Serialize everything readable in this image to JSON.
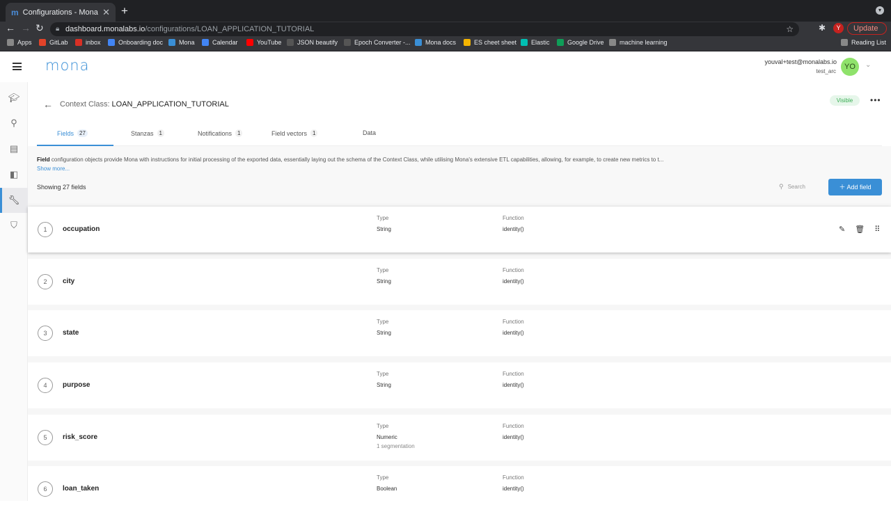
{
  "browser": {
    "tab_title": "Configurations - Mona",
    "url_host": "dashboard.monalabs.io",
    "url_path": "/configurations/LOAN_APPLICATION_TUTORIAL",
    "update_label": "Update",
    "profile_initial": "Y",
    "bookmarks": [
      {
        "label": "Apps",
        "color": "#888888"
      },
      {
        "label": "GitLab",
        "color": "#e24329"
      },
      {
        "label": "inbox",
        "color": "#d93025"
      },
      {
        "label": "Onboarding doc",
        "color": "#4285f4"
      },
      {
        "label": "Mona",
        "color": "#3a8fd6"
      },
      {
        "label": "Calendar",
        "color": "#4285f4"
      },
      {
        "label": "YouTube",
        "color": "#ff0000"
      },
      {
        "label": "JSON beautify",
        "color": "#555555"
      },
      {
        "label": "Epoch Converter -...",
        "color": "#555555"
      },
      {
        "label": "Mona docs",
        "color": "#3a8fd6"
      },
      {
        "label": "ES cheet sheet",
        "color": "#f4b400"
      },
      {
        "label": "Elastic",
        "color": "#00bfb3"
      },
      {
        "label": "Google Drive",
        "color": "#0f9d58"
      },
      {
        "label": "machine learning",
        "color": "#888888"
      }
    ],
    "reading_list": "Reading List"
  },
  "app": {
    "logo": "mona",
    "user_email": "youval+test@monalabs.io",
    "user_org": "test_arc",
    "avatar_initials": "YO"
  },
  "page": {
    "context_label": "Context Class:",
    "context_name": "LOAN_APPLICATION_TUTORIAL",
    "visible_badge": "Visible",
    "tabs": [
      {
        "label": "Fields",
        "count": "27"
      },
      {
        "label": "Stanzas",
        "count": "1"
      },
      {
        "label": "Notifications",
        "count": "1"
      },
      {
        "label": "Field vectors",
        "count": "1"
      },
      {
        "label": "Data",
        "count": ""
      }
    ],
    "description_bold": "Field",
    "description": " configuration objects provide Mona with instructions for initial processing of the exported data, essentially laying out the schema of the Context Class, while utilising Mona's extensive ETL capabilities, allowing, for example, to create new metrics to t...",
    "show_more": "Show more...",
    "showing": "Showing 27 fields",
    "search_placeholder": "Search",
    "add_field": "Add field",
    "type_label": "Type",
    "function_label": "Function"
  },
  "fields": [
    {
      "num": "1",
      "name": "occupation",
      "type": "String",
      "function": "identity()",
      "sub": ""
    },
    {
      "num": "2",
      "name": "city",
      "type": "String",
      "function": "identity()",
      "sub": ""
    },
    {
      "num": "3",
      "name": "state",
      "type": "String",
      "function": "identity()",
      "sub": ""
    },
    {
      "num": "4",
      "name": "purpose",
      "type": "String",
      "function": "identity()",
      "sub": ""
    },
    {
      "num": "5",
      "name": "risk_score",
      "type": "Numeric",
      "function": "identity()",
      "sub": "1 segmentation"
    },
    {
      "num": "6",
      "name": "loan_taken",
      "type": "Boolean",
      "function": "identity()",
      "sub": ""
    }
  ]
}
